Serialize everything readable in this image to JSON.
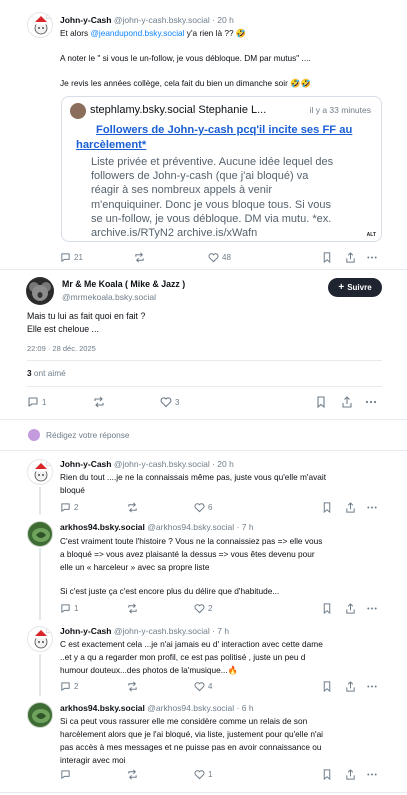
{
  "top_post": {
    "author_name": "John-y-Cash",
    "author_handle": "@john-y-cash.bsky.social",
    "time": "· 20 h",
    "line1_prefix": "Et alors ",
    "line1_mention": "@jeandupond.bsky.social",
    "line1_suffix": " y'a rien là ?? 🤣",
    "line2": "A noter le \" si vous le un-follow, je vous débloque. DM par mutus\" ....",
    "line3": "Je revis les années collège, cela fait du bien un dimanche soir 🤣🤣",
    "quote": {
      "author": "stephlamy.bsky.social Stephanie L...",
      "time": "il y a 33 minutes",
      "title_line1": "Followers de John-y-cash pcq'il incite ses FF au",
      "title_line2": "harcèlement*",
      "body_lines": [
        "Liste privée et préventive. Aucune idée lequel des",
        "followers de John-y-cash (que j'ai bloqué) va",
        "réagir à ses nombreux appels à venir",
        "m'enquiquiner. Donc je vous bloque tous. Si vous",
        "se un-follow, je vous débloque. DM via mutu. *ex.",
        "archive.is/RTyN2 archive.is/xWafn"
      ],
      "badge": "ALT"
    },
    "reply_count": "21",
    "like_count": "48"
  },
  "main_post": {
    "author_name": "Mr & Me Koala ( Mike & Jazz )",
    "author_handle": "@mrmekoala.bsky.social",
    "follow_label": "Suivre",
    "line1": "Mais tu lui as fait quoi en fait ?",
    "line2": "Elle est cheloue ...",
    "timestamp": "22:09 · 28 déc. 2025",
    "likes_number": "3",
    "likes_label": " ont aimé",
    "reply_count": "1",
    "like_count": "3"
  },
  "reply_box": {
    "placeholder": "Rédigez votre réponse"
  },
  "replies": [
    {
      "author_name": "John-y-Cash",
      "author_handle": "@john-y-cash.bsky.social",
      "time": "· 20 h",
      "lines": [
        "Rien du tout ....je ne la connaissais même pas, juste vous qu'elle m'avait",
        "bloqué"
      ],
      "reply_count": "2",
      "like_count": "6"
    },
    {
      "author_name": "arkhos94.bsky.social",
      "author_handle": "@arkhos94.bsky.social",
      "time": "· 7 h",
      "lines": [
        "C'est vraiment toute l'histoire ? Vous ne la connaissiez pas => elle vous",
        "a bloqué => vous avez plaisanté la dessus => vous êtes devenu pour",
        "elle un « harceleur » avec sa propre liste",
        "",
        "Si c'est juste ça c'est encore plus du délire que d'habitude..."
      ],
      "reply_count": "1",
      "like_count": "2"
    },
    {
      "author_name": "John-y-Cash",
      "author_handle": "@john-y-cash.bsky.social",
      "time": "· 7 h",
      "lines": [
        "C est exactement cela ...je n'ai jamais eu d' interaction avec cette dame",
        "..et y a qu a regarder mon profil, ce est pas politisé , juste un peu d",
        "humour douteux...des photos de la'musique...🔥"
      ],
      "reply_count": "2",
      "like_count": "4"
    },
    {
      "author_name": "arkhos94.bsky.social",
      "author_handle": "@arkhos94.bsky.social",
      "time": "· 6 h",
      "lines": [
        "Si ca peut vous rassurer elle me considère comme un relais de son",
        "harcèlement alors que je l'ai bloqué, via liste, justement pour qu'elle n'ai",
        "pas accès à mes messages et ne puisse pas en avoir connaissance ou",
        "interagir avec moi"
      ],
      "reply_count": "",
      "like_count": "1"
    }
  ]
}
